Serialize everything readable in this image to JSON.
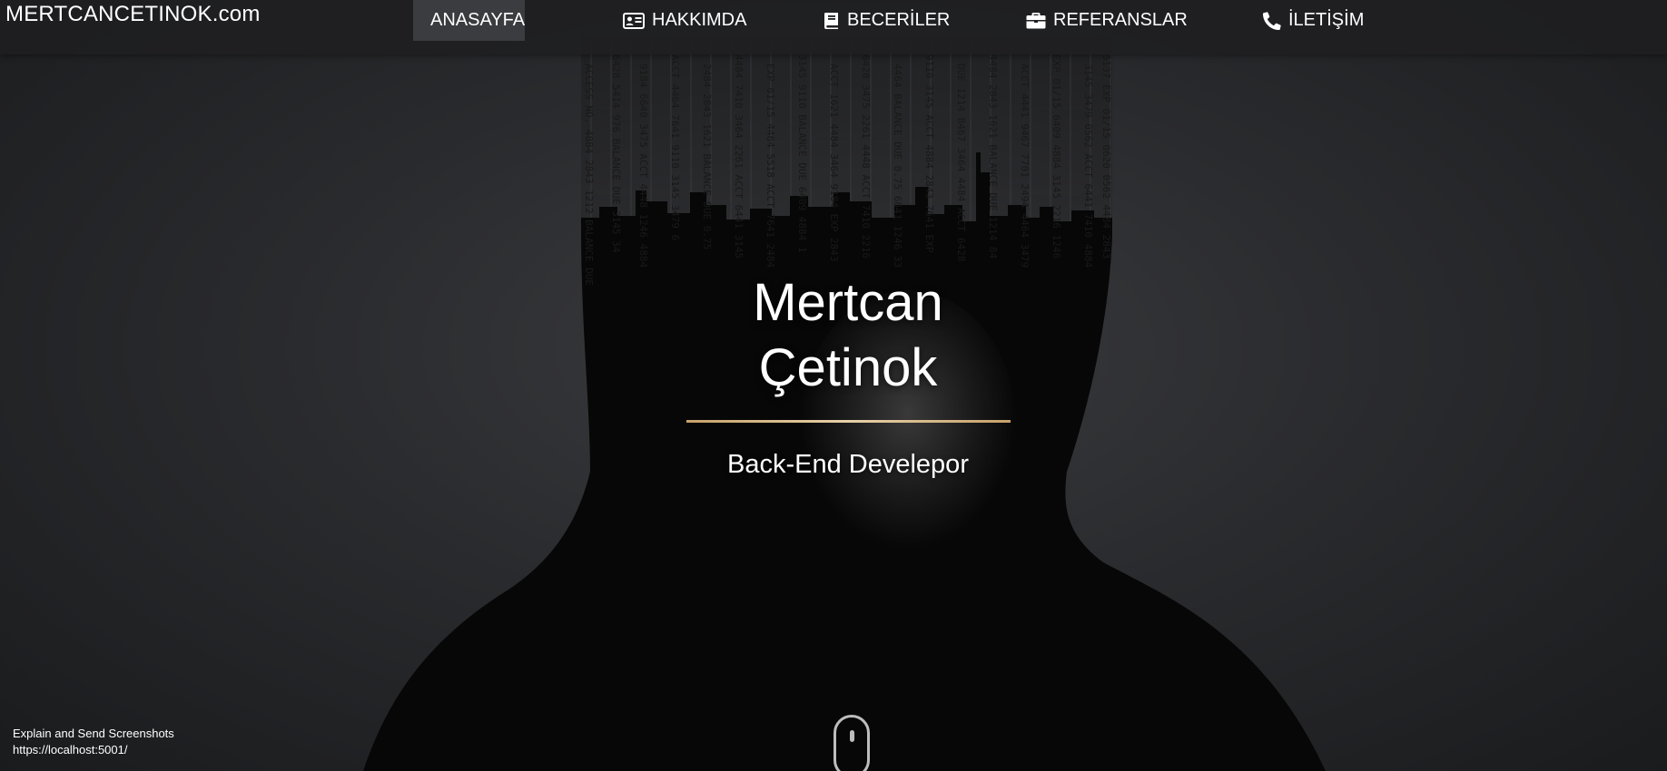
{
  "brand": {
    "title": "MERTCANCETINOK.com"
  },
  "nav": {
    "items": [
      {
        "label": "ANASAYFA",
        "icon": "home-icon",
        "active": true
      },
      {
        "label": "HAKKIMDA",
        "icon": "id-card-icon",
        "active": false
      },
      {
        "label": "BECERİLER",
        "icon": "book-icon",
        "active": false
      },
      {
        "label": "REFERANSLAR",
        "icon": "briefcase-icon",
        "active": false
      },
      {
        "label": "İLETİŞİM",
        "icon": "phone-icon",
        "active": false
      }
    ]
  },
  "hero": {
    "first_name": "Mertcan",
    "last_name": "Çetinok",
    "subtitle": "Back-End Develepor",
    "divider_color": "#d8bb8a",
    "scroll_icon": "mouse-scroll-icon"
  },
  "overlay": {
    "line1": "Explain and Send Screenshots",
    "line2": "https://localhost:5001/"
  }
}
